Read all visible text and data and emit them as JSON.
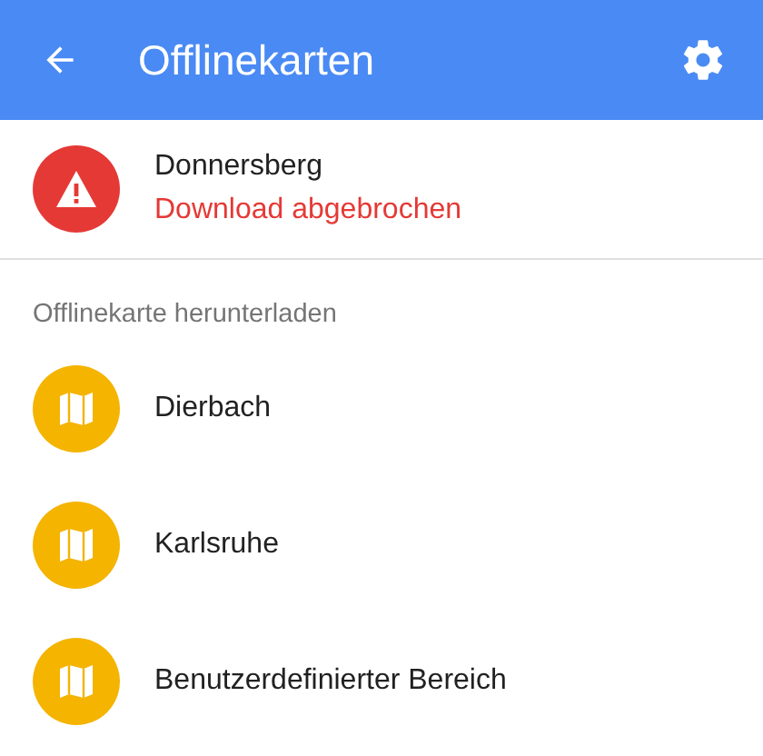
{
  "app_bar": {
    "title": "Offlinekarten"
  },
  "downloads": [
    {
      "name": "Donnersberg",
      "status": "Download abgebrochen",
      "kind": "error"
    }
  ],
  "section": {
    "title": "Offlinekarte herunterladen",
    "items": [
      {
        "label": "Dierbach"
      },
      {
        "label": "Karlsruhe"
      },
      {
        "label": "Benutzerdefinierter Bereich"
      }
    ]
  }
}
